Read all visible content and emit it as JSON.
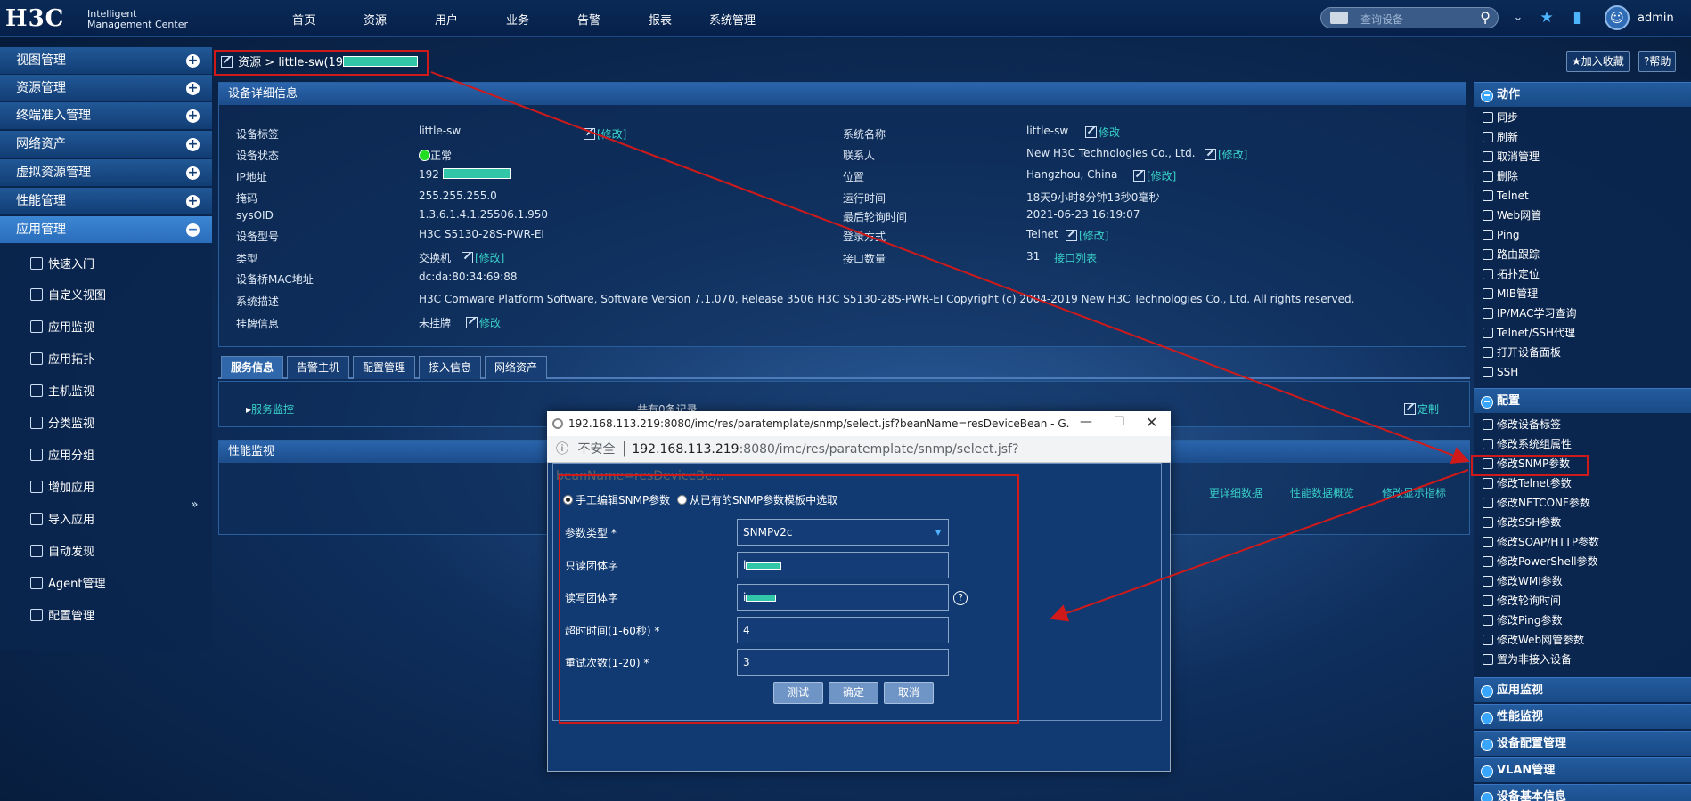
{
  "logo": {
    "brand": "H3C",
    "line1": "Intelligent",
    "line2": "Management Center"
  },
  "nav": [
    "首页",
    "资源",
    "用户",
    "业务",
    "告警",
    "报表",
    "系统管理"
  ],
  "search": {
    "placeholder": "查询设备"
  },
  "user": "admin",
  "sidebar": {
    "groups": [
      {
        "label": "视图管理"
      },
      {
        "label": "资源管理"
      },
      {
        "label": "终端准入管理"
      },
      {
        "label": "网络资产"
      },
      {
        "label": "虚拟资源管理"
      },
      {
        "label": "性能管理"
      },
      {
        "label": "应用管理",
        "active": true
      }
    ],
    "items": [
      "快速入门",
      "自定义视图",
      "应用监视",
      "应用拓扑",
      "主机监视",
      "分类监视",
      "应用分组",
      "增加应用",
      "导入应用",
      "自动发现",
      "Agent管理",
      "配置管理"
    ],
    "more": "»"
  },
  "breadcrumb": {
    "root": "资源",
    "sep": ">",
    "current": "little-sw(19"
  },
  "topbuttons": {
    "fav": "加入收藏",
    "help": "帮助"
  },
  "device_panel": {
    "title": "设备详细信息",
    "edit": "[修改]",
    "edit2": "修改",
    "left": [
      {
        "label": "设备标签",
        "value": "little-sw"
      },
      {
        "label": "设备状态",
        "value": "正常"
      },
      {
        "label": "IP地址",
        "value": "192"
      },
      {
        "label": "掩码",
        "value": "255.255.255.0"
      },
      {
        "label": "sysOID",
        "value": "1.3.6.1.4.1.25506.1.950"
      },
      {
        "label": "设备型号",
        "value": "H3C S5130-28S-PWR-EI"
      },
      {
        "label": "类型",
        "value": "交换机"
      },
      {
        "label": "设备桥MAC地址",
        "value": "dc:da:80:34:69:88"
      },
      {
        "label": "系统描述",
        "value": "H3C Comware Platform Software, Software Version 7.1.070, Release 3506 H3C S5130-28S-PWR-EI Copyright (c) 2004-2019 New H3C Technologies Co., Ltd. All rights reserved."
      },
      {
        "label": "挂牌信息",
        "value": "未挂牌"
      }
    ],
    "right": [
      {
        "label": "系统名称",
        "value": "little-sw"
      },
      {
        "label": "联系人",
        "value": "New H3C Technologies Co., Ltd."
      },
      {
        "label": "位置",
        "value": "Hangzhou, China"
      },
      {
        "label": "运行时间",
        "value": "18天9小时8分钟13秒0毫秒"
      },
      {
        "label": "最后轮询时间",
        "value": "2021-06-23 16:19:07"
      },
      {
        "label": "登录方式",
        "value": "Telnet"
      },
      {
        "label": "接口数量",
        "value": "31",
        "link": "接口列表"
      }
    ]
  },
  "tabs": [
    "服务信息",
    "告警主机",
    "配置管理",
    "接入信息",
    "网络资产"
  ],
  "service": {
    "monitor": "服务监控",
    "count": "共有0条记录",
    "custom": "定制"
  },
  "perf": {
    "title": "性能监视",
    "links": [
      "更详细数据",
      "性能数据概览",
      "修改显示指标"
    ]
  },
  "popup": {
    "title": "192.168.113.219:8080/imc/res/paratemplate/snmp/select.jsf?beanName=resDeviceBean - G...",
    "insecure": "不安全",
    "url_host": "192.168.113.219",
    "url_rest": ":8080/imc/res/paratemplate/snmp/select.jsf?beanName=resDeviceBe...",
    "radio1": "手工编辑SNMP参数",
    "radio2": "从已有的SNMP参数模板中选取",
    "fields": [
      {
        "label": "参数类型 *",
        "value": "SNMPv2c"
      },
      {
        "label": "只读团体字",
        "value": "i"
      },
      {
        "label": "读写团体字",
        "value": "i"
      },
      {
        "label": "超时时间(1-60秒) *",
        "value": "4"
      },
      {
        "label": "重试次数(1-20) *",
        "value": "3"
      }
    ],
    "buttons": [
      "测试",
      "确定",
      "取消"
    ]
  },
  "right_panel": {
    "sections": [
      "动作",
      "配置",
      "应用监视",
      "性能监视",
      "设备配置管理",
      "VLAN管理",
      "设备基本信息"
    ],
    "actions": [
      "同步",
      "刷新",
      "取消管理",
      "删除",
      "Telnet",
      "Web网管",
      "Ping",
      "路由跟踪",
      "拓扑定位",
      "MIB管理",
      "IP/MAC学习查询",
      "Telnet/SSH代理",
      "打开设备面板",
      "SSH"
    ],
    "config": [
      "修改设备标签",
      "修改系统组属性",
      "修改SNMP参数",
      "修改Telnet参数",
      "修改NETCONF参数",
      "修改SSH参数",
      "修改SOAP/HTTP参数",
      "修改PowerShell参数",
      "修改WMI参数",
      "修改轮询时间",
      "修改Ping参数",
      "修改Web网管参数",
      "置为非接入设备"
    ]
  },
  "colors": {
    "accent": "#39d0c8",
    "alert": "#d01a1a",
    "ok": "#22dd22"
  }
}
